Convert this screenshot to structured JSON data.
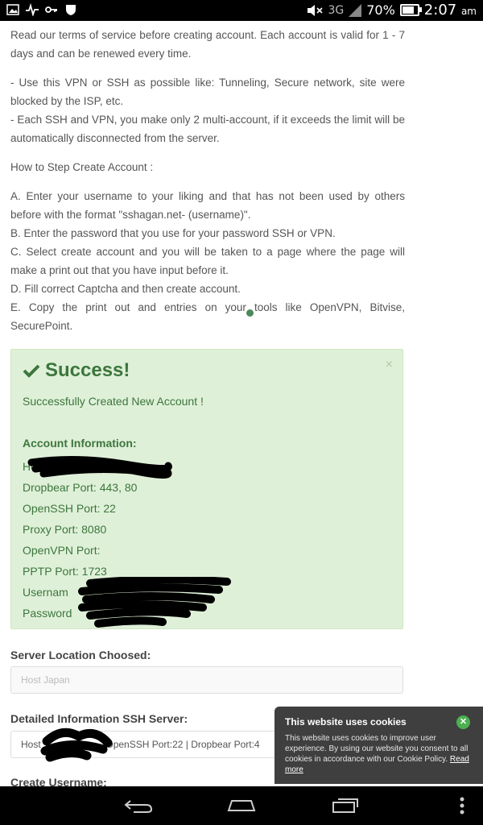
{
  "status": {
    "network": "3G",
    "battery": "70%",
    "battery_level": 0.7,
    "time": "2:07",
    "ampm": "am"
  },
  "terms": {
    "p1": "Read our terms of service before creating account. Each account is valid for 1 - 7 days and can be renewed every time.",
    "p2": "- Use this VPN or SSH as possible like: Tunneling, Secure network, site were blocked by the ISP, etc.",
    "p3": "- Each SSH and VPN, you make only 2 multi-account, if it exceeds the limit will be automatically disconnected from the server.",
    "how": "How to Step Create Account :",
    "steps": [
      "A. Enter your username to your liking and that has not been used by others before with the format \"sshagan.net- (username)\".",
      "B. Enter the password that you use for your password SSH or VPN.",
      "C. Select create account and you will be taken to a page where the page will make a print out that you have input before it.",
      "D. Fill correct Captcha and then create account.",
      "E. Copy the print out and entries on your tools like OpenVPN, Bitvise, SecurePoint."
    ]
  },
  "alert": {
    "title": "Success!",
    "close": "×",
    "message": "Successfully Created New Account !",
    "account_header": "Account Information:",
    "rows": [
      "Ho",
      "Dropbear Port: 443, 80",
      "OpenSSH Port: 22",
      "Proxy Port: 8080",
      "OpenVPN Port:",
      "PPTP Port: 1723",
      "Usernam",
      "Password"
    ]
  },
  "server_location": {
    "label": "Server Location Choosed:",
    "value": "Host Japan"
  },
  "detailed": {
    "label": "Detailed Information SSH Server:",
    "value_prefix": "Host",
    "value_suffix": "OpenSSH Port:22 | Dropbear Port:4"
  },
  "create_username": {
    "label": "Create Username:"
  },
  "cookie": {
    "title": "This website uses cookies",
    "body": "This website uses cookies to improve user experience. By using our website you consent to all cookies in accordance with our Cookie Policy.",
    "link": "Read more"
  },
  "colors": {
    "success_bg": "#dff0d8",
    "success_text": "#3c763d",
    "cookie_bg": "#3f3f3f",
    "cookie_close": "#4caf50"
  }
}
